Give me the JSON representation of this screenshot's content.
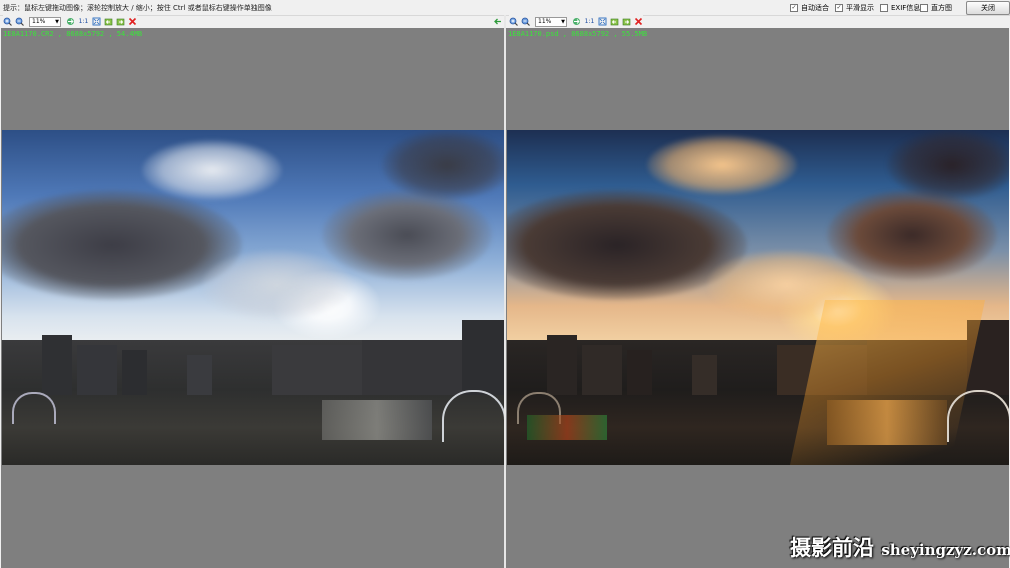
{
  "top": {
    "hint": "提示：鼠标左键拖动图像；滚轮控制放大 / 缩小；按住 Ctrl 或者鼠标右键操作单独图像",
    "options": [
      {
        "label": "自动适合",
        "checked": true
      },
      {
        "label": "平滑显示",
        "checked": true
      },
      {
        "label": "EXIF信息",
        "checked": false
      },
      {
        "label": "直方图",
        "checked": false
      }
    ],
    "close_label": "关闭"
  },
  "toolbar": {
    "zoom_value": "11%",
    "actual_size_label": "1:1"
  },
  "left": {
    "info": "1E8A1170.CR2 , 8688x5792 , 54.4MB"
  },
  "right": {
    "info": "1E8A1170.psd , 8688x5792 , 55.5MB"
  },
  "watermark": {
    "cn": "摄影前沿",
    "domain": "sheyingzyz.com"
  },
  "icons": [
    "zoom-in-icon",
    "zoom-out-icon",
    "zoom-select",
    "actual-size",
    "fit-icon",
    "prev-icon",
    "next-icon",
    "delete-icon",
    "back-arrow-icon"
  ],
  "colors": {
    "accent": "#3be33b",
    "panel_bg": "#7f7f7f",
    "delete": "#e02020"
  }
}
